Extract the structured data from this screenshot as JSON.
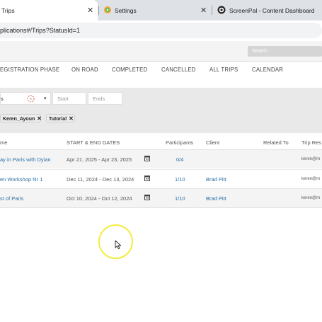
{
  "browser": {
    "tabs": [
      {
        "title": "Trips",
        "close": "✕"
      },
      {
        "title": "Settings",
        "close": "✕"
      },
      {
        "title": "ScreenPal - Content Dashboard",
        "close": "✕"
      }
    ],
    "url": "plications#/Trips?StatusId=1"
  },
  "topbar": {
    "search_placeholder": "Search"
  },
  "nav": {
    "tabs": [
      "EGISTRATION PHASE",
      "ON ROAD",
      "COMPLETED",
      "CANCELLED",
      "ALL TRIPS",
      "CALENDAR"
    ]
  },
  "filters": {
    "select_value": "s",
    "start_placeholder": "Start",
    "end_placeholder": "Ends",
    "chips": [
      {
        "label": "Keren_Ayoun",
        "remove": "✕"
      },
      {
        "label": "Tutorial",
        "remove": "✕"
      }
    ]
  },
  "table": {
    "headers": [
      "me",
      "START & END DATES",
      "Participants",
      "Client",
      "Related To",
      "Trip Res"
    ],
    "rows": [
      {
        "name": "ay in Paris with Dyian",
        "dates": "Apr 21, 2025 - Apr 23, 2025",
        "participants": "0/4",
        "client": "",
        "related": "",
        "email": "keren@m"
      },
      {
        "name": "en Workshop Nr 1",
        "dates": "Dec 11, 2024 - Dec 13, 2024",
        "participants": "1/10",
        "client": "Brad Pitt",
        "related": "",
        "email": "keren@m"
      },
      {
        "name": "st of Paris",
        "dates": "Oct 10, 2024 - Oct 12, 2024",
        "participants": "1/10",
        "client": "Brad Pitt",
        "related": "",
        "email": "keren@m"
      }
    ]
  },
  "colors": {
    "accent_link": "#2a6fa8",
    "cursor_highlight": "#f4ec3d",
    "tab_strip": "#dee1e6"
  }
}
